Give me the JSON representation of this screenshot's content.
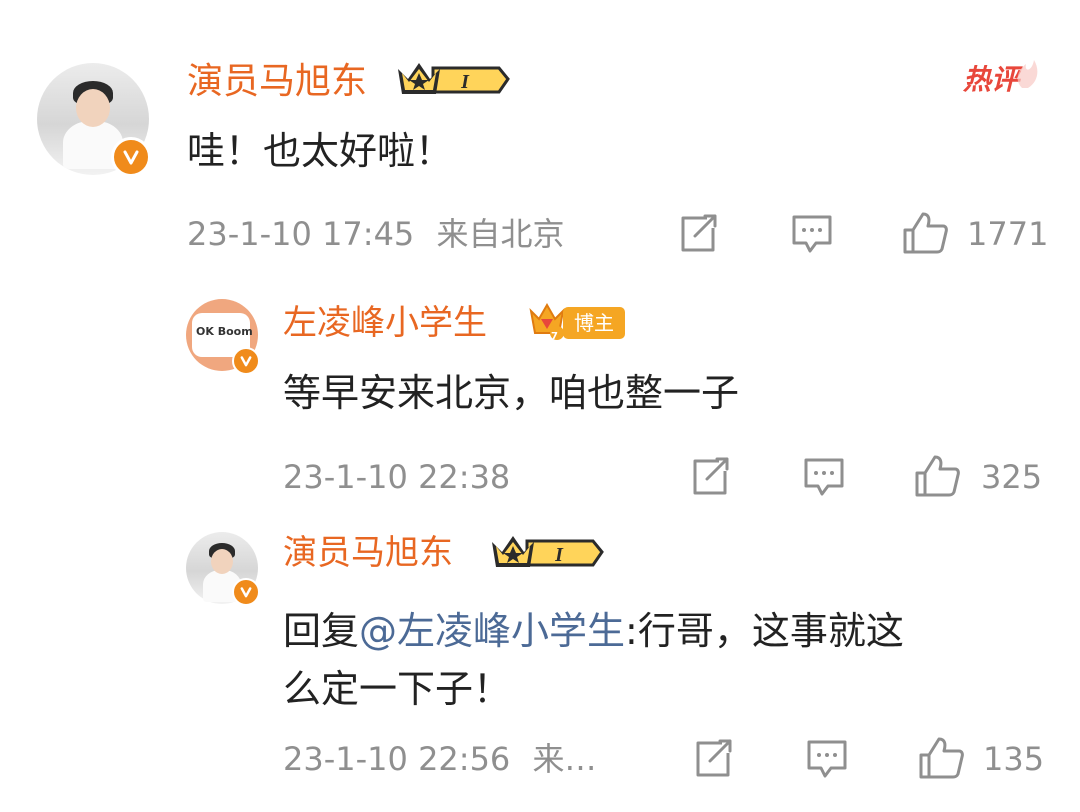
{
  "hot_label": "热评",
  "comments": [
    {
      "username": "演员马旭东",
      "badge_text": "I",
      "text": "哇！也太好啦！",
      "time": "23-1-10 17:45",
      "location": "来自北京",
      "likes": "1771"
    },
    {
      "username": "左凌峰小学生",
      "badge_text": "博主",
      "badge_level": "7",
      "avatar_text": "OK Boom",
      "text": "等早安来北京，咱也整一子",
      "time": "23-1-10 22:38",
      "likes": "325"
    },
    {
      "username": "演员马旭东",
      "badge_text": "I",
      "reply_prefix": "回复",
      "mention": "@左凌峰小学生",
      "text_line1": ":行哥，这事就这",
      "text_line2": "么定一下子！",
      "time": "23-1-10 22:56",
      "location": "来…",
      "likes": "135"
    }
  ],
  "colors": {
    "username": "#e86722",
    "text": "#222222",
    "meta": "#8f8f8f",
    "mention": "#4c6a96",
    "verified": "#f08b1b",
    "hot": "#e8473b"
  },
  "icons": [
    "share-icon",
    "comment-icon",
    "like-icon",
    "verified-icon",
    "crown-badge-icon"
  ]
}
